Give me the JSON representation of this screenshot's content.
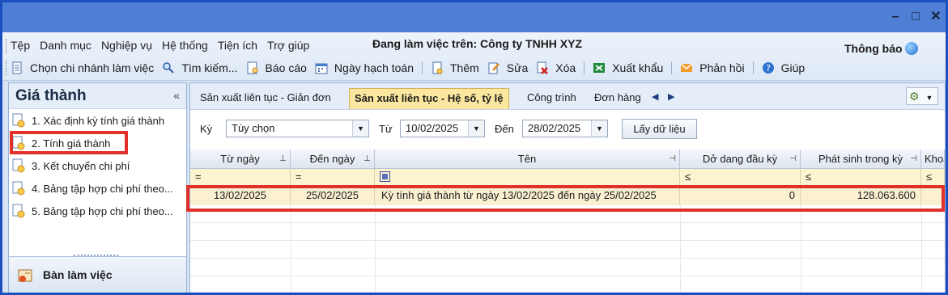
{
  "window": {
    "controls": {
      "minimize": "–",
      "maximize": "□",
      "close": "✕"
    }
  },
  "menu": {
    "items": [
      "Tệp",
      "Danh mục",
      "Nghiệp vụ",
      "Hệ thống",
      "Tiện ích",
      "Trợ giúp"
    ],
    "working_label": "Đang làm việc trên: Công ty TNHH XYZ",
    "notice_label": "Thông báo"
  },
  "toolbar": {
    "branch": "Chọn chi nhánh làm việc",
    "search": "Tìm kiếm...",
    "report": "Báo cáo",
    "date": "Ngày hạch toán",
    "add": "Thêm",
    "edit": "Sửa",
    "delete": "Xóa",
    "export": "Xuất khẩu",
    "feedback": "Phản hồi",
    "help": "Giúp"
  },
  "sidebar": {
    "title": "Giá thành",
    "collapse": "«",
    "items": [
      {
        "label": "1. Xác định kỳ tính giá thành"
      },
      {
        "label": "2. Tính giá thành"
      },
      {
        "label": "3. Kết chuyển chi phí"
      },
      {
        "label": "4. Bảng tập hợp chi phí theo..."
      },
      {
        "label": "5. Bảng tập hợp chi phí theo..."
      }
    ],
    "bottom_label": "Bàn làm việc"
  },
  "tabs": [
    {
      "label": "Sản xuất liên tục - Giản đơn"
    },
    {
      "label": "Sản xuất liên tục - Hệ số, tỷ lệ"
    },
    {
      "label": "Công trình"
    },
    {
      "label": "Đơn hàng"
    }
  ],
  "filters": {
    "period_label": "Kỳ",
    "period_value": "Tùy chọn",
    "from_label": "Từ",
    "from_value": "10/02/2025",
    "to_label": "Đến",
    "to_value": "28/02/2025",
    "load_button": "Lấy dữ liệu"
  },
  "grid": {
    "columns": [
      "Từ ngày",
      "Đến ngày",
      "Tên",
      "Dở dang đầu kỳ",
      "Phát sinh trong kỳ",
      "Khoả"
    ],
    "filter_ops": [
      "=",
      "=",
      "",
      "≤",
      "≤",
      "≤"
    ],
    "rows": [
      {
        "from": "13/02/2025",
        "to": "25/02/2025",
        "name": "Kỳ tính giá thành từ ngày 13/02/2025 đến ngày 25/02/2025",
        "opening": "0",
        "incurred": "128.063.600"
      }
    ]
  },
  "colors": {
    "accent": "#e0312b",
    "titlebar": "#4f7fd4",
    "selected_tab": "#fbe7a0",
    "row_highlight": "#fbf1d2"
  }
}
